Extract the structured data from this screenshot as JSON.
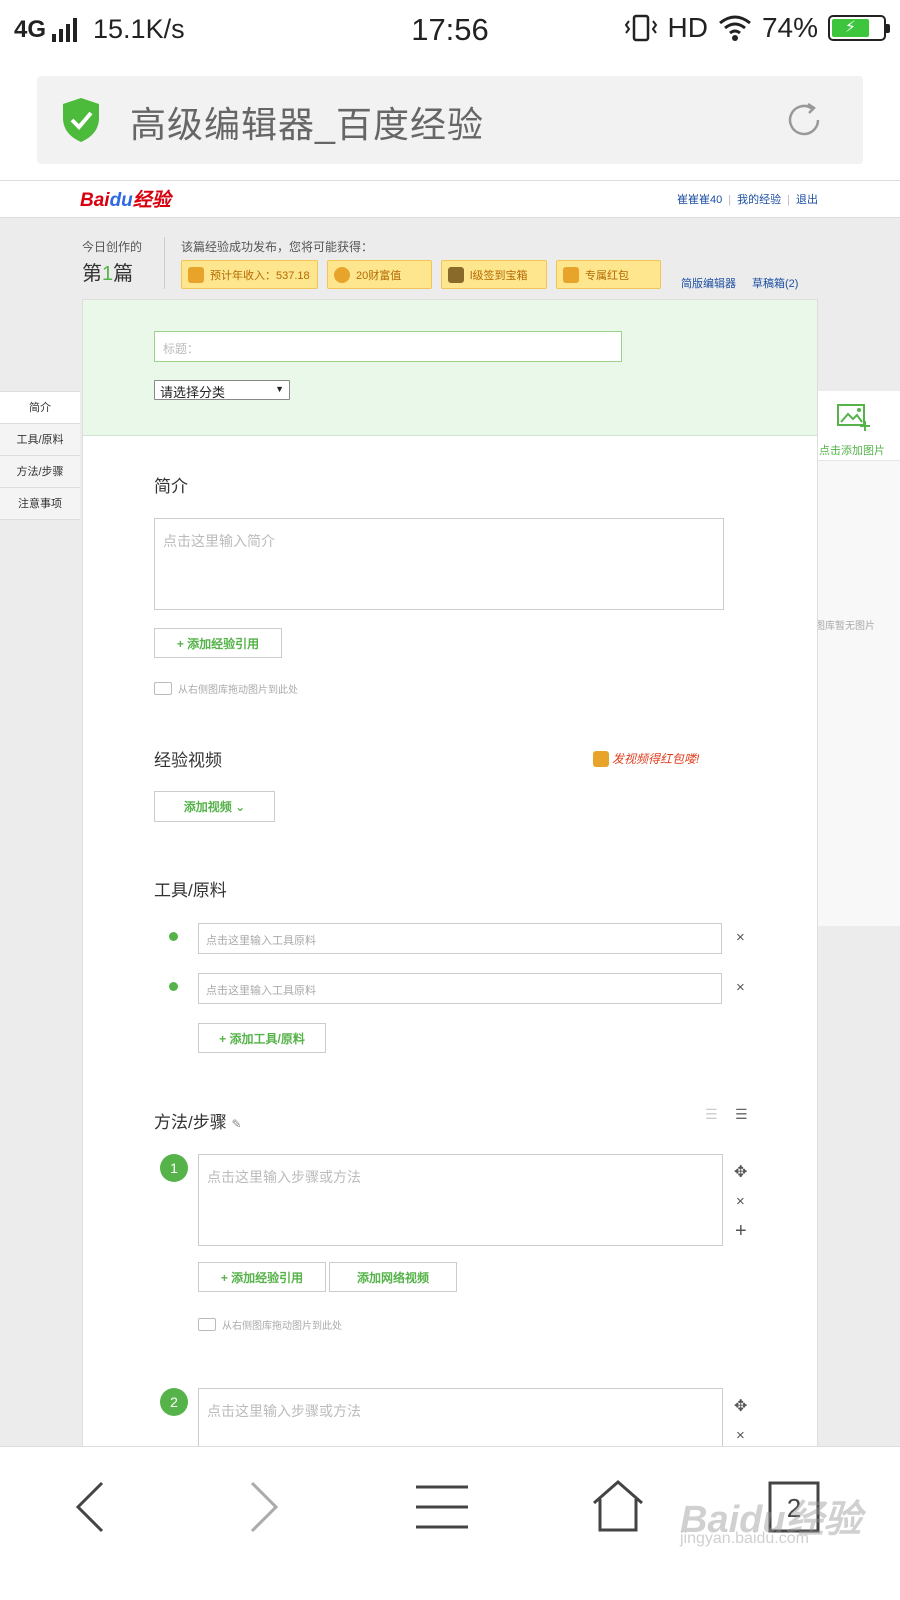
{
  "status": {
    "network": "4G",
    "speed": "15.1K/s",
    "time": "17:56",
    "hd": "HD",
    "battery": "74%"
  },
  "browser": {
    "page_title": "高级编辑器_百度经验"
  },
  "site": {
    "logo_main": "Bai",
    "logo_du": "du",
    "logo_sub": "经验",
    "user": "崔崔崔40",
    "my_exp": "我的经验",
    "logout": "退出"
  },
  "today": {
    "label": "今日创作的",
    "prefix": "第",
    "count": "1",
    "suffix": "篇"
  },
  "rewards": {
    "label": "该篇经验成功发布，您将可能获得：",
    "items": [
      "预计年收入：537.18",
      "20财富值",
      "l级签到宝箱",
      "专属红包"
    ]
  },
  "links": {
    "simple_editor": "简版编辑器",
    "drafts": "草稿箱(2)"
  },
  "form": {
    "title_placeholder": "标题：",
    "category_value": "请选择分类"
  },
  "leftnav": [
    "简介",
    "工具/原料",
    "方法/步骤",
    "注意事项"
  ],
  "right": {
    "add_image": "点击添加图片",
    "no_images": "图库暂无图片"
  },
  "intro": {
    "title": "简介",
    "placeholder": "点击这里输入简介",
    "add_ref": "+ 添加经验引用",
    "drag_hint": "从右侧图库拖动图片到此处"
  },
  "video": {
    "title": "经验视频",
    "promo": "发视频得红包喽!",
    "add_btn": "添加视频 ⌄"
  },
  "tools": {
    "title": "工具/原料",
    "placeholder": "点击这里输入工具原料",
    "add_btn": "+ 添加工具/原料",
    "close": "×"
  },
  "steps": {
    "title": "方法/步骤",
    "placeholder": "点击这里输入步骤或方法",
    "add_ref": "+ 添加经验引用",
    "add_video": "添加网络视频",
    "drag_hint": "从右侧图库拖动图片到此处",
    "nums": [
      "1",
      "2"
    ],
    "close": "×",
    "plus": "+"
  },
  "watermark": {
    "main": "Baidu经验",
    "sub": "jingyan.baidu.com"
  },
  "colors": {
    "accent": "#56b34a",
    "link": "#1e50a2",
    "logo_red": "#d8000e",
    "reward_bg": "#fde68e"
  }
}
